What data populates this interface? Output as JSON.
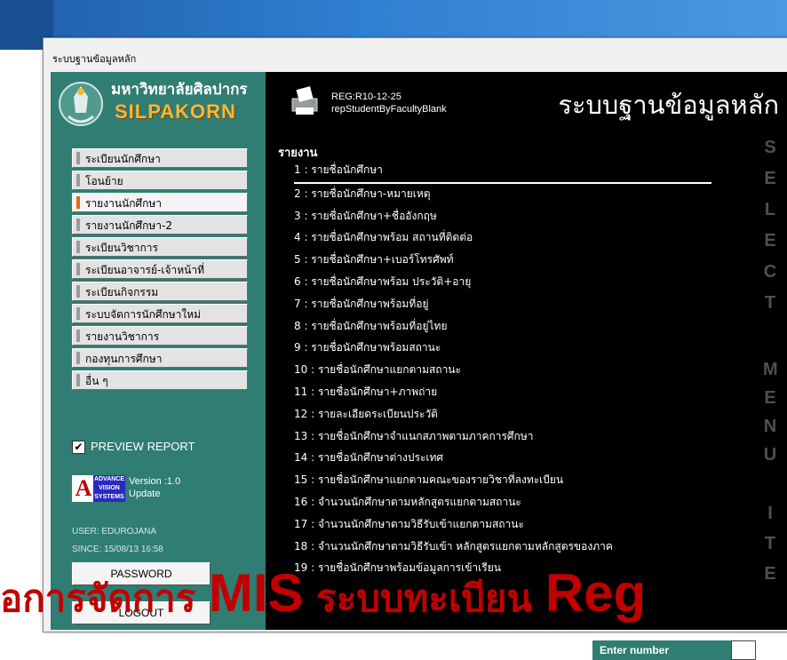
{
  "window": {
    "title": "ระบบฐานข้อมูลหลัก"
  },
  "logo": {
    "thai_name": "มหาวิทยาลัยศิลปากร",
    "english_name": "SILPAKORN"
  },
  "menu": {
    "items": [
      {
        "label": "ระเบียนนักศึกษา",
        "active": false
      },
      {
        "label": "โอนย้าย",
        "active": false
      },
      {
        "label": "รายงานนักศึกษา",
        "active": true
      },
      {
        "label": "รายงานนักศึกษา-2",
        "active": false
      },
      {
        "label": "ระเบียนวิชาการ",
        "active": false
      },
      {
        "label": "ระเบียนอาจารย์-เจ้าหน้าที่",
        "active": false
      },
      {
        "label": "ระเบียนกิจกรรม",
        "active": false
      },
      {
        "label": "ระบบจัดการนักศึกษาใหม่",
        "active": false
      },
      {
        "label": "รายงานวิชาการ",
        "active": false
      },
      {
        "label": "กองทุนการศึกษา",
        "active": false
      },
      {
        "label": "อื่น ๆ",
        "active": false
      }
    ]
  },
  "preview": {
    "checked": true,
    "checkmark": "✔",
    "label": "PREVIEW REPORT"
  },
  "vendor": {
    "letter": "A",
    "badge_lines": [
      "ADVANCE",
      "VISION",
      "SYSTEMS"
    ],
    "version_line": "Version :1.0",
    "update_line": "Update"
  },
  "session": {
    "user": "USER: EDUROJANA",
    "since": "SINCE: 15/08/13 16:58"
  },
  "buttons": {
    "password": "PASSWORD",
    "logout": "LOGOUT"
  },
  "header": {
    "report_code": "REG:R10-12-25",
    "report_name": "repStudentByFacultyBlank",
    "title": "ระบบฐานข้อมูลหลัก"
  },
  "reports": {
    "heading": "รายงาน",
    "items": [
      "1 : รายชื่อนักศึกษา",
      "2 : รายชื่อนักศึกษา-หมายเหตุ",
      "3 : รายชื่อนักศึกษา+ชื่ออังกฤษ",
      "4 : รายชื่อนักศึกษาพร้อม สถานที่ติดต่อ",
      "5 : รายชื่อนักศึกษา+เบอร์โทรศัพท์",
      "6 : รายชื่อนักศึกษาพร้อม ประวัติ+อายุ",
      "7 : รายชื่อนักศึกษาพร้อมที่อยู่",
      "8 : รายชื่อนักศึกษาพร้อมที่อยู่ไทย",
      "9 : รายชื่อนักศึกษาพร้อมสถานะ",
      "10 : รายชื่อนักศึกษาแยกตามสถานะ",
      "11 : รายชื่อนักศึกษา+ภาพถ่าย",
      "12 : รายละเอียดระเบียนประวัติ",
      "13 : รายชื่อนักศึกษาจำแนกสภาพตามภาคการศึกษา",
      "14 : รายชื่อนักศึกษาต่างประเทศ",
      "15 : รายชื่อนักศึกษาแยกตามคณะของรายวิชาที่ลงทะเบียน",
      "16 : จำนวนนักศึกษาตามหลักสูตรแยกตามสถานะ",
      "17 : จำนวนนักศึกษาตามวิธีรับเข้าแยกตามสถานะ",
      "18 : จำนวนนักศึกษาตามวิธีรับเข้า หลักสูตรแยกตามหลักสูตรของภาค",
      "19 : รายชื่อนักศึกษาพร้อมข้อมูลการเข้าเรียน"
    ],
    "selected_index": 0
  },
  "side_letters": {
    "select": [
      "S",
      "E",
      "L",
      "E",
      "C",
      "T"
    ],
    "menu": [
      "M",
      "E",
      "N",
      "U"
    ],
    "item": [
      "I",
      "T",
      "E"
    ]
  },
  "enter": {
    "label": "Enter number"
  },
  "overlay": {
    "part1": "อการจัดการ ",
    "part2": "MIS",
    "part3": " ระบบทะเบียน ",
    "part4": "Reg"
  },
  "colors": {
    "panel": "#2f7d73",
    "accent": "#e06a12",
    "overlay_text": "#c20000",
    "logo_gold": "#f6b63a"
  }
}
